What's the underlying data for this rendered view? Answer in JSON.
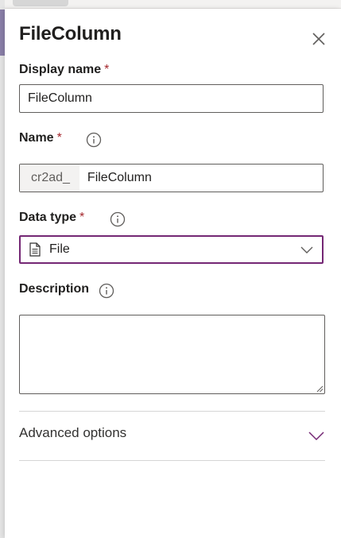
{
  "panel": {
    "title": "FileColumn",
    "close_icon": "close-icon"
  },
  "display_name": {
    "label": "Display name",
    "required_marker": "*",
    "value": "FileColumn"
  },
  "name": {
    "label": "Name",
    "required_marker": "*",
    "info_icon": "info-icon",
    "prefix": "cr2ad_",
    "value": "FileColumn"
  },
  "data_type": {
    "label": "Data type",
    "required_marker": "*",
    "info_icon": "info-icon",
    "selected": "File",
    "selected_icon": "file-icon"
  },
  "description": {
    "label": "Description",
    "info_icon": "info-icon",
    "value": ""
  },
  "advanced": {
    "label": "Advanced options",
    "chevron_icon": "chevron-down-icon"
  },
  "colors": {
    "accent": "#742774",
    "required": "#a4262c",
    "border": "#605e5c"
  }
}
